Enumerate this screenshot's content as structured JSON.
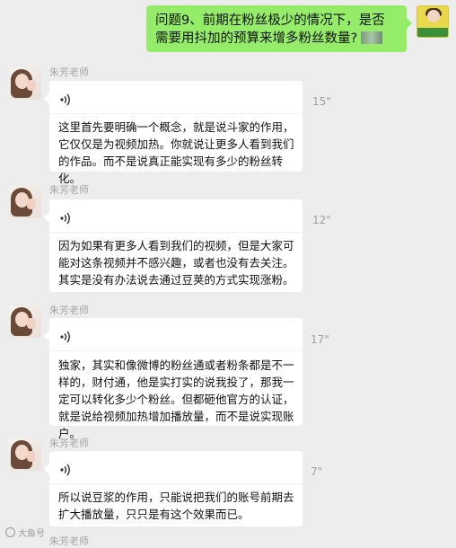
{
  "outgoing": {
    "text": "问题9、前期在粉丝极少的情况下，是否需要用抖加的预算来增多粉丝数量?"
  },
  "sender_name": "朱芳老师",
  "messages": [
    {
      "duration": "15\"",
      "transcript": "这里首先要明确一个概念，就是说斗家的作用，它仅仅是为视频加热。你就说让更多人看到我们的作品。而不是说真正能实现有多少的粉丝转化。"
    },
    {
      "duration": "12\"",
      "transcript": "因为如果有更多人看到我们的视频，但是大家可能对这条视频并不感兴趣，或者也没有去关注。其实是没有办法说去通过豆荚的方式实现涨粉。"
    },
    {
      "duration": "17\"",
      "transcript": "独家，其实和像微博的粉丝通或者粉条都是不一样的，财付通，他是实打实的说我投了，那我一定可以转化多少个粉丝。但都砸他官方的认证，就是说给视频加热增加播放量，而不是说实现账户。"
    },
    {
      "duration": "7\"",
      "transcript": "所以说豆浆的作用，只能说把我们的账号前期去扩大播放量，只只是有这个效果而已。"
    }
  ],
  "watermark": "大鱼号"
}
